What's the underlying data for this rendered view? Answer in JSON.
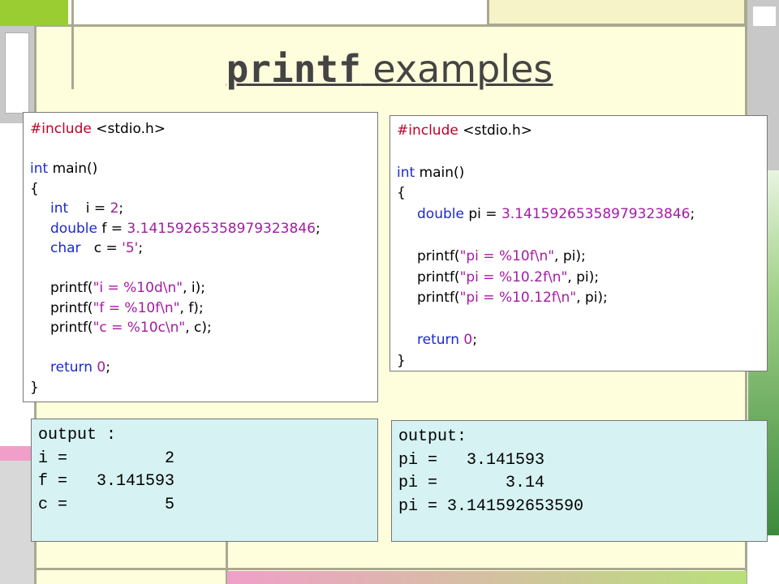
{
  "slide": {
    "title_code": "printf",
    "title_rest": " examples"
  },
  "left_code": {
    "include_kw": "#include",
    "include_hdr": " <stdio.h>",
    "main_type": "int",
    "main_name": " main()",
    "open_brace": "{",
    "l1_type": "int",
    "l1_rest": "    i = ",
    "l1_val": "2",
    "l1_end": ";",
    "l2_type": "double",
    "l2_rest": " f = ",
    "l2_val": "3.14159265358979323846",
    "l2_end": ";",
    "l3_type": "char",
    "l3_rest": "   c = ",
    "l3_val": "'5'",
    "l3_end": ";",
    "p1_a": "printf(",
    "p1_s": "\"i = %10d\\n\"",
    "p1_b": ", i);",
    "p2_a": "printf(",
    "p2_s": "\"f = %10f\\n\"",
    "p2_b": ", f);",
    "p3_a": "printf(",
    "p3_s": "\"c = %10c\\n\"",
    "p3_b": ", c);",
    "ret_kw": "return",
    "ret_val": " 0",
    "ret_end": ";",
    "close_brace": "}"
  },
  "right_code": {
    "include_kw": "#include",
    "include_hdr": " <stdio.h>",
    "main_type": "int",
    "main_name": " main()",
    "open_brace": "{",
    "d_type": "double",
    "d_rest": " pi = ",
    "d_val": "3.14159265358979323846",
    "d_end": ";",
    "p1_a": "printf(",
    "p1_s": "\"pi = %10f\\n\"",
    "p1_b": ", pi);",
    "p2_a": "printf(",
    "p2_s": "\"pi = %10.2f\\n\"",
    "p2_b": ", pi);",
    "p3_a": "printf(",
    "p3_s": "\"pi = %10.12f\\n\"",
    "p3_b": ", pi);",
    "ret_kw": "return",
    "ret_val": " 0",
    "ret_end": ";",
    "close_brace": "}"
  },
  "left_output": {
    "lines": [
      "output :",
      "i =          2",
      "f =   3.141593",
      "c =          5"
    ]
  },
  "right_output": {
    "lines": [
      "output:",
      "pi =   3.141593",
      "pi =       3.14",
      "pi = 3.141592653590"
    ]
  },
  "colors": {
    "keyword": "#1a2ad0",
    "preprocessor": "#c0002a",
    "literal": "#a31ba3",
    "output_bg": "#d6f2f2",
    "slide_bg": "#fffedc"
  }
}
